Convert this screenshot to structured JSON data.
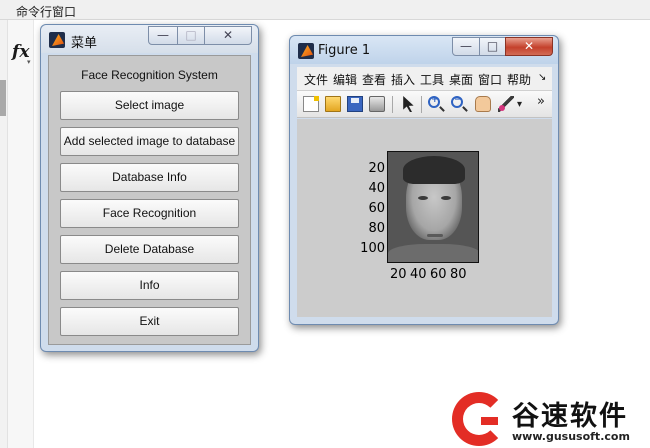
{
  "command_window": {
    "title": "命令行窗口",
    "fx_symbol": "fx"
  },
  "menu_window": {
    "title": "菜单",
    "controls": {
      "minimize": "—",
      "maximize": "□",
      "close": "✕"
    },
    "heading": "Face Recognition System",
    "buttons": [
      "Select image",
      "Add selected image to database",
      "Database Info",
      "Face Recognition",
      "Delete Database",
      "Info",
      "Exit"
    ]
  },
  "figure_window": {
    "title": "Figure 1",
    "controls": {
      "minimize": "—",
      "maximize": "□",
      "close": "✕"
    },
    "menu": [
      "文件",
      "编辑",
      "查看",
      "插入",
      "工具",
      "桌面",
      "窗口",
      "帮助"
    ],
    "menu_overflow": "↘",
    "toolbar_overflow": "»",
    "toolbar_dropdown": "▾",
    "toolbar_icons": [
      "new-file-icon",
      "open-folder-icon",
      "save-icon",
      "print-icon",
      "pointer-arrow-icon",
      "zoom-in-icon",
      "zoom-out-icon",
      "pan-hand-icon",
      "data-brush-icon"
    ],
    "zoom_in_glyph": "+",
    "zoom_out_glyph": "−",
    "axes": {
      "y_ticks": [
        "20",
        "40",
        "60",
        "80",
        "100"
      ],
      "x_ticks": [
        "20",
        "40",
        "60",
        "80"
      ]
    }
  },
  "watermark": {
    "name": "谷速软件",
    "url": "www.gususoft.com",
    "accent_color": "#e32d25"
  }
}
